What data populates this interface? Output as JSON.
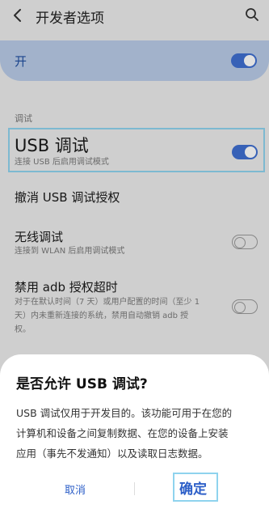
{
  "header": {
    "title": "开发者选项",
    "back_icon": "arrow-left-icon",
    "search_icon": "search-icon"
  },
  "master_toggle": {
    "label": "开",
    "state": "on"
  },
  "section": {
    "title": "调试"
  },
  "settings": [
    {
      "title": "USB 调试",
      "subtitle": "连接 USB 后启用调试模式",
      "toggle": "on"
    },
    {
      "title": "撤消 USB 调试授权"
    },
    {
      "title": "无线调试",
      "subtitle": "连接到 WLAN 后启用调试模式",
      "toggle": "off"
    },
    {
      "title": "禁用 adb 授权超时",
      "subtitle_lines": [
        "对于在默认时间（7 天）或用户配置的时间（至少 1",
        "天）内未重新连接的系统，禁用自动撤销 adb 授",
        "权。"
      ],
      "toggle": "off"
    }
  ],
  "dialog": {
    "title": "是否允许 USB 调试?",
    "body_lines": [
      "USB 调试仅用于开发目的。该功能可用于在您的",
      "计算机和设备之间复制数据、在您的设备上安装",
      "应用（事先不发通知）以及读取日志数据。"
    ],
    "cancel_label": "取消",
    "confirm_label": "确定"
  },
  "colors": {
    "accent": "#3f6fd1",
    "highlight": "#8fd3ee",
    "master_card": "#b9cbe8"
  }
}
